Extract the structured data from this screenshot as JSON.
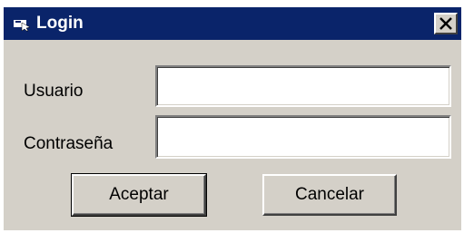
{
  "window": {
    "title": "Login",
    "title_icon": "window-app-icon",
    "close_icon": "close-icon",
    "colors": {
      "titlebar": "#0a246a",
      "face": "#d4d0c8"
    }
  },
  "form": {
    "username_label": "Usuario",
    "username_value": "",
    "password_label": "Contraseña",
    "password_value": ""
  },
  "buttons": {
    "accept_label": "Aceptar",
    "cancel_label": "Cancelar"
  }
}
